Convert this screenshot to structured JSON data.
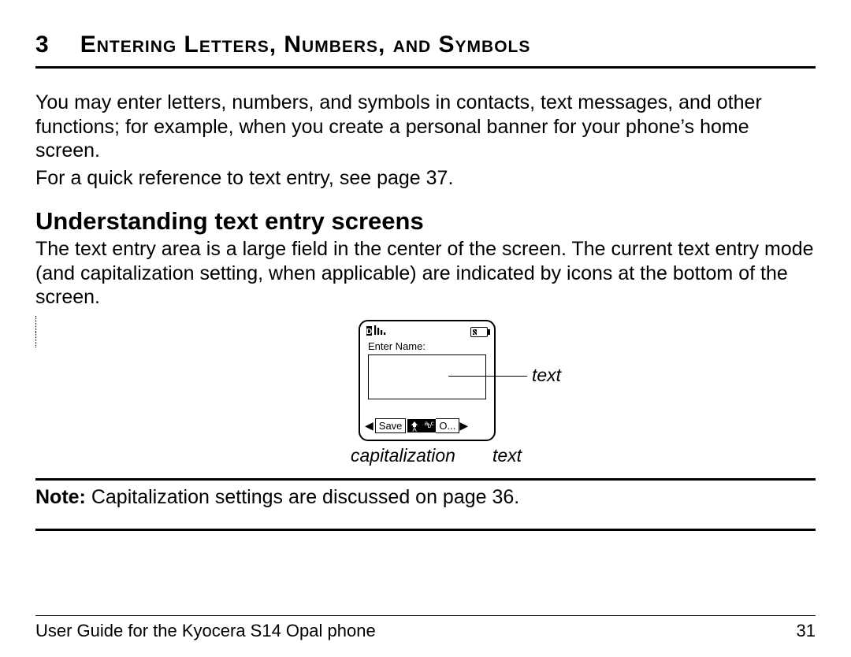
{
  "chapter": {
    "number": "3",
    "title": "Entering Letters, Numbers, and Symbols"
  },
  "intro": {
    "p1": "You may enter letters, numbers, and symbols in contacts, text messages, and other functions; for example, when you create a personal banner for your phone’s home screen.",
    "p2": "For a quick reference to text entry, see page 37."
  },
  "section": {
    "heading": "Understanding text entry screens",
    "body": "The text entry area is a large field in the center of the screen. The current text entry mode (and capitalization setting, when applicable) are indicated by icons at the bottom of the screen."
  },
  "figure": {
    "prompt": "Enter Name:",
    "softkey_left": "Save",
    "softkey_right": "O...",
    "mode_cap": "⇧",
    "mode_abc": "abc",
    "callout_text": "text",
    "callout_cap": "capitalization",
    "callout_text2": "text"
  },
  "note": {
    "label": "Note:",
    "body": " Capitalization settings are discussed on page 36."
  },
  "footer": {
    "left": "User Guide for the Kyocera S14 Opal phone",
    "right": "31"
  }
}
